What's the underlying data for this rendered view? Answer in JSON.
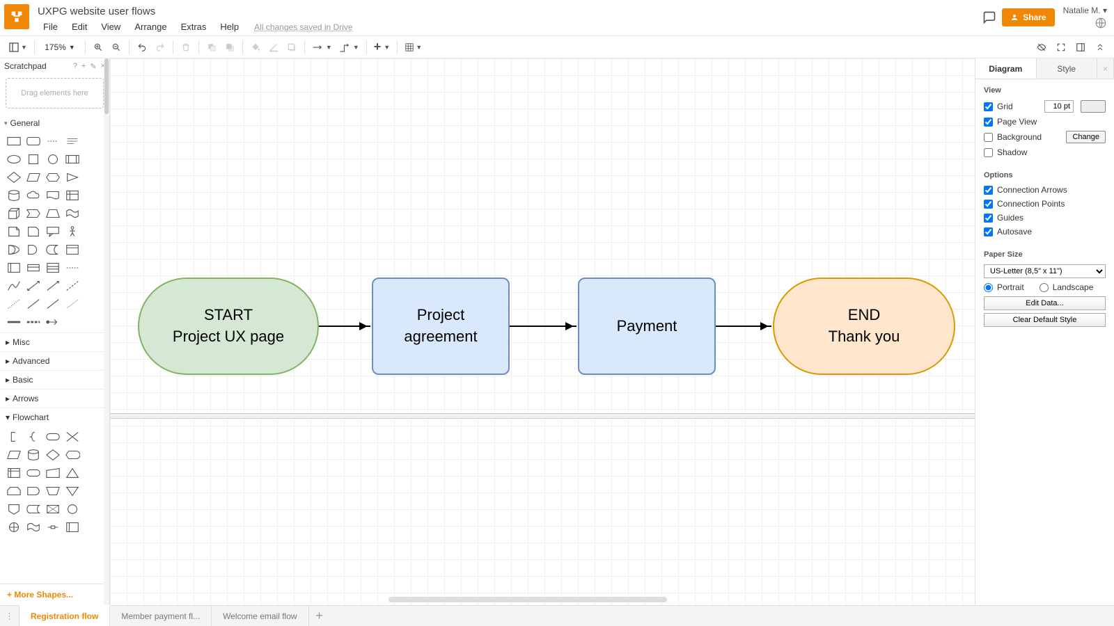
{
  "header": {
    "title": "UXPG website user flows",
    "menu": [
      "File",
      "Edit",
      "View",
      "Arrange",
      "Extras",
      "Help"
    ],
    "save_status": "All changes saved in Drive",
    "user": "Natalie M.",
    "share": "Share"
  },
  "toolbar": {
    "zoom": "175%"
  },
  "sidebar": {
    "scratchpad_title": "Scratchpad",
    "scratchpad_hint": "Drag elements here",
    "sections": {
      "general": "General",
      "misc": "Misc",
      "advanced": "Advanced",
      "basic": "Basic",
      "arrows": "Arrows",
      "flowchart": "Flowchart"
    },
    "more_shapes": "+  More Shapes..."
  },
  "canvas": {
    "nodes": {
      "start_l1": "START",
      "start_l2": "Project UX page",
      "agree_l1": "Project",
      "agree_l2": "agreement",
      "payment": "Payment",
      "end_l1": "END",
      "end_l2": "Thank you"
    }
  },
  "rpanel": {
    "tabs": {
      "diagram": "Diagram",
      "style": "Style"
    },
    "view": {
      "title": "View",
      "grid": "Grid",
      "grid_val": "10 pt",
      "page_view": "Page View",
      "background": "Background",
      "change": "Change",
      "shadow": "Shadow"
    },
    "options": {
      "title": "Options",
      "conn_arrows": "Connection Arrows",
      "conn_points": "Connection Points",
      "guides": "Guides",
      "autosave": "Autosave"
    },
    "paper": {
      "title": "Paper Size",
      "size": "US-Letter (8,5\" x 11\")",
      "portrait": "Portrait",
      "landscape": "Landscape"
    },
    "buttons": {
      "edit_data": "Edit Data...",
      "clear_style": "Clear Default Style"
    }
  },
  "bottom": {
    "tabs": [
      "Registration flow",
      "Member payment fl...",
      "Welcome email flow"
    ]
  },
  "chart_data": {
    "type": "flowchart",
    "nodes": [
      {
        "id": "start",
        "shape": "terminator",
        "label": "START\nProject UX page",
        "fill": "#d5e8d4",
        "stroke": "#82b366"
      },
      {
        "id": "agree",
        "shape": "process",
        "label": "Project\nagreement",
        "fill": "#dae8fc",
        "stroke": "#6c8ebf"
      },
      {
        "id": "payment",
        "shape": "process",
        "label": "Payment",
        "fill": "#dae8fc",
        "stroke": "#6c8ebf"
      },
      {
        "id": "end",
        "shape": "terminator",
        "label": "END\nThank you",
        "fill": "#ffe6cc",
        "stroke": "#d79b00"
      }
    ],
    "edges": [
      {
        "from": "start",
        "to": "agree"
      },
      {
        "from": "agree",
        "to": "payment"
      },
      {
        "from": "payment",
        "to": "end"
      }
    ]
  }
}
